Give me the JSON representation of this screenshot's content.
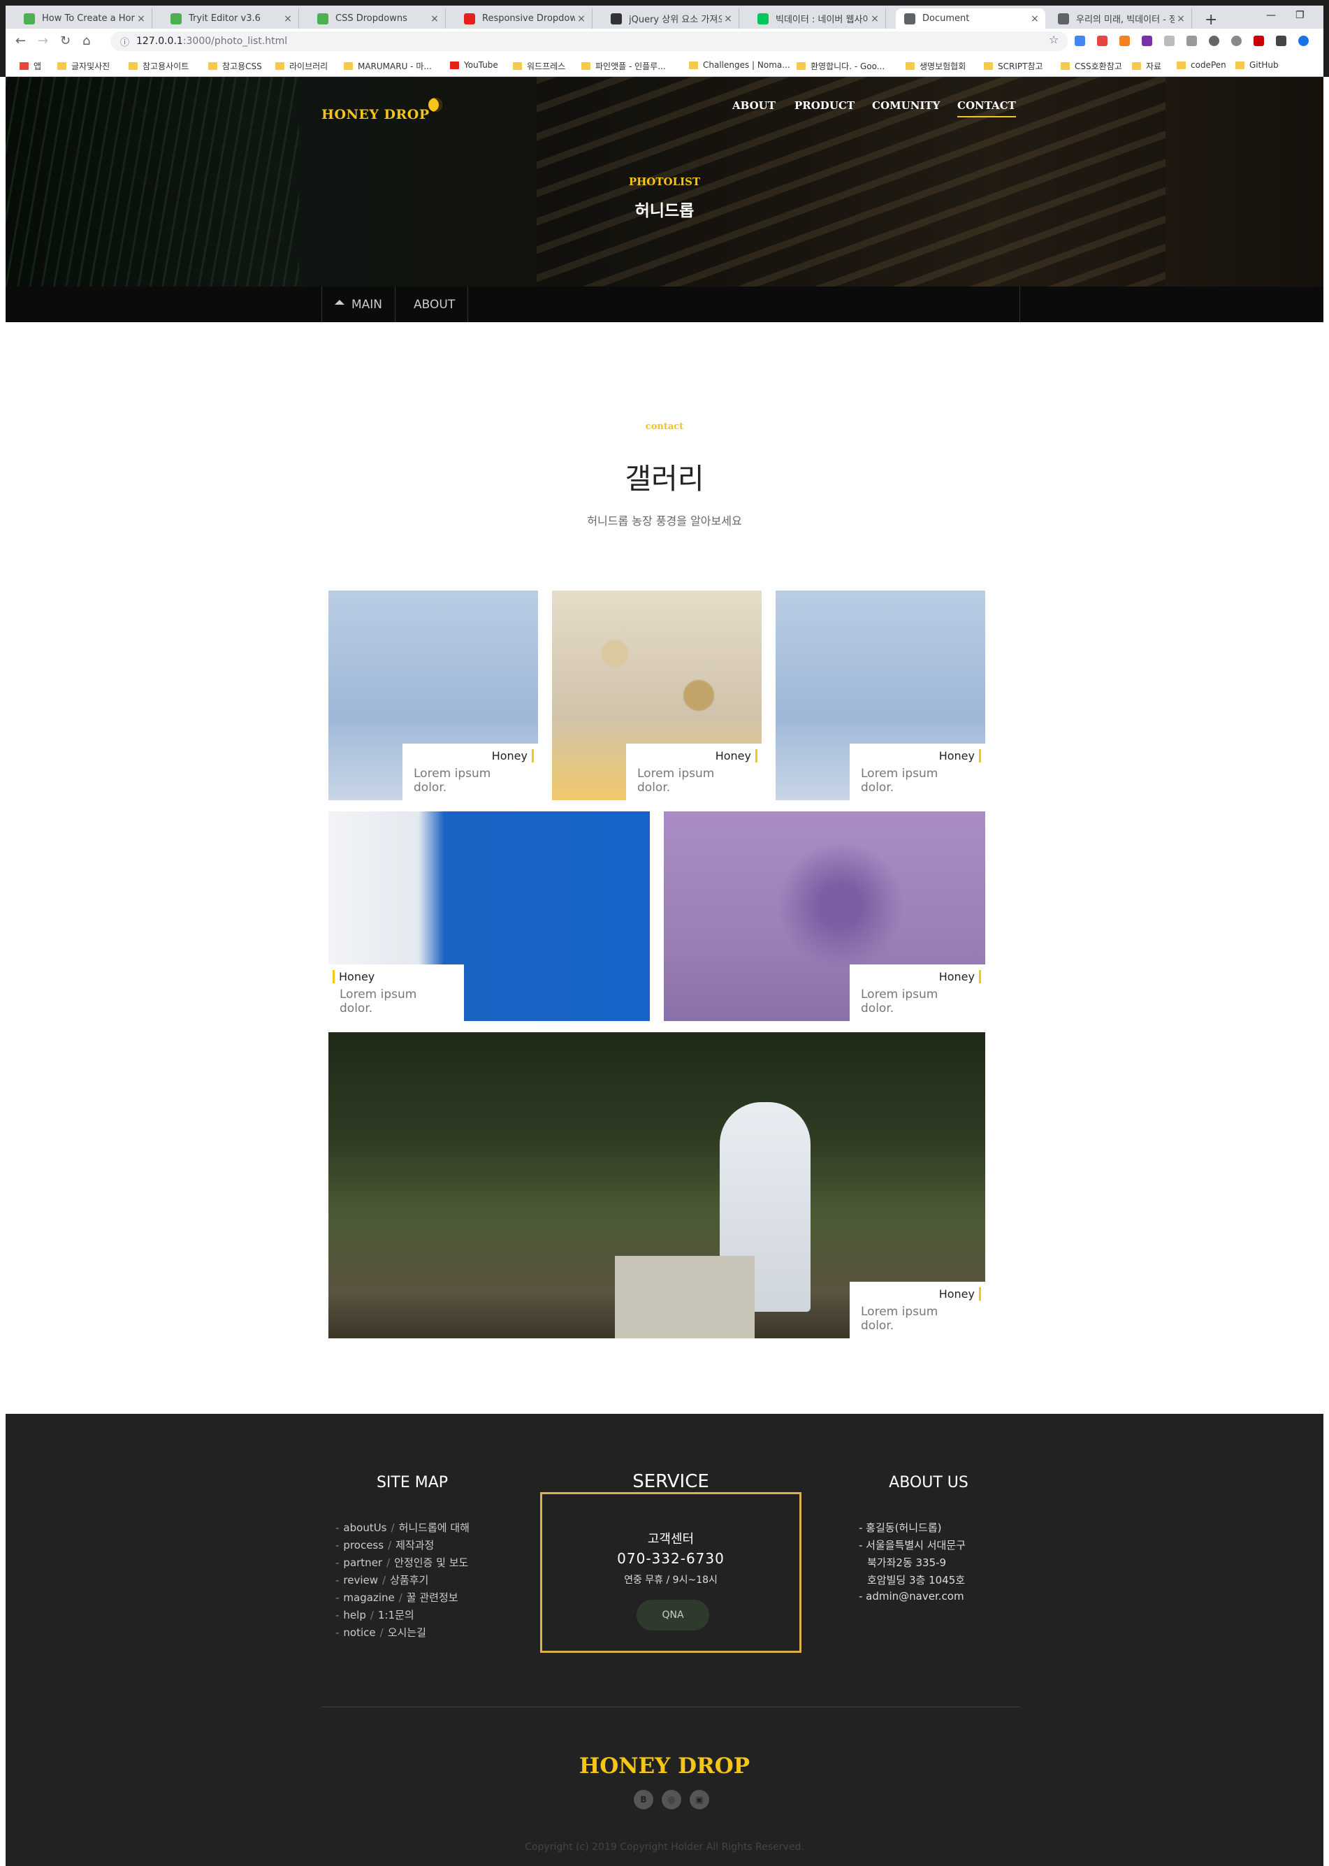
{
  "browser": {
    "tabs": [
      {
        "title": "How To Create a Horizontal",
        "favicon_color": "#4caf50"
      },
      {
        "title": "Tryit Editor v3.6",
        "favicon_color": "#4caf50"
      },
      {
        "title": "CSS Dropdowns",
        "favicon_color": "#4caf50"
      },
      {
        "title": "Responsive Dropdown Nav",
        "favicon_color": "#e62117"
      },
      {
        "title": "jQuery 상위 요소 가져오기",
        "favicon_color": "#333333"
      },
      {
        "title": "빅데이터 : 네이버 웹사이트",
        "favicon_color": "#03c75a"
      },
      {
        "title": "Document",
        "favicon_color": "#5f6368"
      },
      {
        "title": "우리의 미래, 빅데이터 - 정",
        "favicon_color": "#5f6368"
      }
    ],
    "url_host": "127.0.0.1",
    "url_path": ":3000/photo_list.html",
    "bookmarks": [
      "앱",
      "글자및사진",
      "참고용사이트",
      "참고용CSS",
      "라이브러리",
      "MARUMARU - 마...",
      "YouTube",
      "워드프레스",
      "파인앳플 - 인플루...",
      "Challenges | Noma...",
      "환영합니다. - Goo...",
      "생명보험협회",
      "SCRIPT참고",
      "CSS호환참고",
      "자료",
      "codePen",
      "GitHub"
    ]
  },
  "site": {
    "logo": "HONEY DROP",
    "menu": [
      "ABOUT",
      "PRODUCT",
      "COMUNITY",
      "CONTACT"
    ],
    "active_menu": "CONTACT",
    "hero": {
      "subtitle": "PHOTOLIST",
      "title": "허니드롭"
    },
    "breadcrumb": [
      "MAIN",
      "ABOUT"
    ]
  },
  "section": {
    "label": "contact",
    "title": "갤러리",
    "description": "허니드롭 농장 풍경을 알아보세요"
  },
  "gallery": [
    {
      "title": "Honey",
      "desc": "Lorem ipsum dolor."
    },
    {
      "title": "Honey",
      "desc": "Lorem ipsum dolor."
    },
    {
      "title": "Honey",
      "desc": "Lorem ipsum dolor."
    },
    {
      "title": "Honey",
      "desc": "Lorem ipsum dolor."
    },
    {
      "title": "Honey",
      "desc": "Lorem ipsum dolor."
    },
    {
      "title": "Honey",
      "desc": "Lorem ipsum dolor."
    }
  ],
  "footer": {
    "sitemap_title": "SITE MAP",
    "sitemap": [
      {
        "en": "aboutUs",
        "ko": "허니드롭에 대해"
      },
      {
        "en": "process",
        "ko": "제작과정"
      },
      {
        "en": "partner",
        "ko": "안정인증 및 보도"
      },
      {
        "en": "review",
        "ko": "상품후기"
      },
      {
        "en": "magazine",
        "ko": "꿀 관련정보"
      },
      {
        "en": "help",
        "ko": "1:1문의"
      },
      {
        "en": "notice",
        "ko": "오시는길"
      }
    ],
    "service_title": "SERVICE",
    "service": {
      "center": "고객센터",
      "phone": "070-332-6730",
      "hours": "연중 무휴 / 9시~18시",
      "qna": "QNA"
    },
    "about_title": "ABOUT US",
    "about": [
      "- 홍길동(허니드롭)",
      "- 서울을특별시 서대문구",
      "북가좌2동 335-9",
      "호암빌딩 3층 1045호",
      "- admin@naver.com"
    ],
    "logo": "HONEY DROP",
    "social": [
      "B",
      "◎",
      "▣"
    ],
    "copyright": "Copyright (c) 2019 Copyright Holder All Rights Reserved."
  },
  "colors": {
    "accent": "#f5c518",
    "footer_bg": "#222222",
    "service_border": "#d9b14a"
  }
}
